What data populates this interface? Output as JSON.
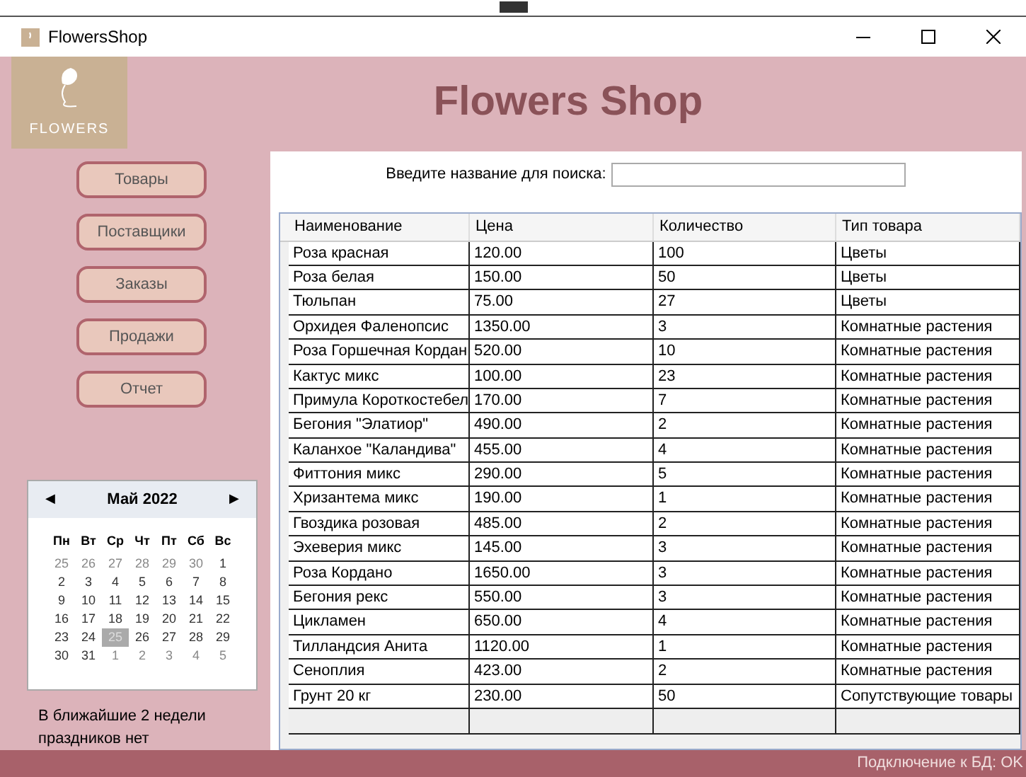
{
  "window": {
    "title": "FlowersShop"
  },
  "logo": {
    "text": "FLOWERS"
  },
  "header": {
    "title": "Flowers Shop"
  },
  "nav": [
    {
      "label": "Товары"
    },
    {
      "label": "Поставщики"
    },
    {
      "label": "Заказы"
    },
    {
      "label": "Продажи"
    },
    {
      "label": "Отчет"
    }
  ],
  "calendar": {
    "month": "Май 2022",
    "prev": "◀",
    "next": "▶",
    "weekdays": [
      "Пн",
      "Вт",
      "Ср",
      "Чт",
      "Пт",
      "Сб",
      "Вс"
    ],
    "days": [
      {
        "text": "25",
        "muted": true,
        "selected": false
      },
      {
        "text": "26",
        "muted": true,
        "selected": false
      },
      {
        "text": "27",
        "muted": true,
        "selected": false
      },
      {
        "text": "28",
        "muted": true,
        "selected": false
      },
      {
        "text": "29",
        "muted": true,
        "selected": false
      },
      {
        "text": "30",
        "muted": true,
        "selected": false
      },
      {
        "text": "1",
        "muted": false,
        "selected": false
      },
      {
        "text": "2",
        "muted": false,
        "selected": false
      },
      {
        "text": "3",
        "muted": false,
        "selected": false
      },
      {
        "text": "4",
        "muted": false,
        "selected": false
      },
      {
        "text": "5",
        "muted": false,
        "selected": false
      },
      {
        "text": "6",
        "muted": false,
        "selected": false
      },
      {
        "text": "7",
        "muted": false,
        "selected": false
      },
      {
        "text": "8",
        "muted": false,
        "selected": false
      },
      {
        "text": "9",
        "muted": false,
        "selected": false
      },
      {
        "text": "10",
        "muted": false,
        "selected": false
      },
      {
        "text": "11",
        "muted": false,
        "selected": false
      },
      {
        "text": "12",
        "muted": false,
        "selected": false
      },
      {
        "text": "13",
        "muted": false,
        "selected": false
      },
      {
        "text": "14",
        "muted": false,
        "selected": false
      },
      {
        "text": "15",
        "muted": false,
        "selected": false
      },
      {
        "text": "16",
        "muted": false,
        "selected": false
      },
      {
        "text": "17",
        "muted": false,
        "selected": false
      },
      {
        "text": "18",
        "muted": false,
        "selected": false
      },
      {
        "text": "19",
        "muted": false,
        "selected": false
      },
      {
        "text": "20",
        "muted": false,
        "selected": false
      },
      {
        "text": "21",
        "muted": false,
        "selected": false
      },
      {
        "text": "22",
        "muted": false,
        "selected": false
      },
      {
        "text": "23",
        "muted": false,
        "selected": false
      },
      {
        "text": "24",
        "muted": false,
        "selected": false
      },
      {
        "text": "25",
        "muted": false,
        "selected": true
      },
      {
        "text": "26",
        "muted": false,
        "selected": false
      },
      {
        "text": "27",
        "muted": false,
        "selected": false
      },
      {
        "text": "28",
        "muted": false,
        "selected": false
      },
      {
        "text": "29",
        "muted": false,
        "selected": false
      },
      {
        "text": "30",
        "muted": false,
        "selected": false
      },
      {
        "text": "31",
        "muted": false,
        "selected": false
      },
      {
        "text": "1",
        "muted": true,
        "selected": false
      },
      {
        "text": "2",
        "muted": true,
        "selected": false
      },
      {
        "text": "3",
        "muted": true,
        "selected": false
      },
      {
        "text": "4",
        "muted": true,
        "selected": false
      },
      {
        "text": "5",
        "muted": true,
        "selected": false
      }
    ]
  },
  "holidays_note": "В ближайшие 2 недели праздников нет",
  "search": {
    "label": "Введите название для поиска:"
  },
  "table": {
    "columns": [
      "Наименование",
      "Цена",
      "Количество",
      "Тип товара"
    ],
    "rows": [
      [
        "Роза красная",
        "120.00",
        "100",
        "Цветы"
      ],
      [
        "Роза белая",
        "150.00",
        "50",
        "Цветы"
      ],
      [
        "Тюльпан",
        "75.00",
        "27",
        "Цветы"
      ],
      [
        "Орхидея Фаленопсис",
        "1350.00",
        "3",
        "Комнатные растения"
      ],
      [
        "Роза Горшечная Кордан",
        "520.00",
        "10",
        "Комнатные растения"
      ],
      [
        "Кактус микс",
        "100.00",
        "23",
        "Комнатные растения"
      ],
      [
        "Примула Короткостебел",
        "170.00",
        "7",
        "Комнатные растения"
      ],
      [
        "Бегония \"Элатиор\"",
        "490.00",
        "2",
        "Комнатные растения"
      ],
      [
        "Каланхое \"Каландива\"",
        "455.00",
        "4",
        "Комнатные растения"
      ],
      [
        "Фиттония микс",
        "290.00",
        "5",
        "Комнатные растения"
      ],
      [
        "Хризантема микс",
        "190.00",
        "1",
        "Комнатные растения"
      ],
      [
        "Гвоздика розовая",
        "485.00",
        "2",
        "Комнатные растения"
      ],
      [
        "Эхеверия микс",
        "145.00",
        "3",
        "Комнатные растения"
      ],
      [
        "Роза Кордано",
        "1650.00",
        "3",
        "Комнатные растения"
      ],
      [
        "Бегония рекс",
        "550.00",
        "3",
        "Комнатные растения"
      ],
      [
        "Цикламен",
        "650.00",
        "4",
        "Комнатные растения"
      ],
      [
        "Тилландсия Анита",
        "1120.00",
        "1",
        "Комнатные растения"
      ],
      [
        "Сеноплия",
        "423.00",
        "2",
        "Комнатные растения"
      ],
      [
        "Грунт 20 кг",
        "230.00",
        "50",
        "Сопутствующие товары"
      ]
    ]
  },
  "status_bar": "Подключение к БД: OK"
}
